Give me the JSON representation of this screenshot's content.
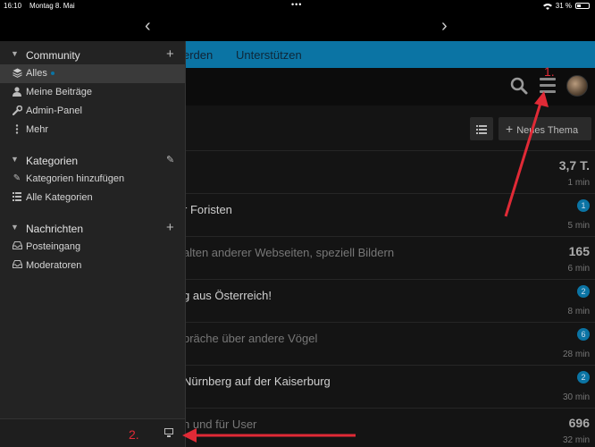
{
  "statusbar": {
    "time": "16:10",
    "date": "Montag 8. Mai",
    "dots": "•••",
    "battery": "31 %"
  },
  "browser": {
    "back": "‹",
    "forward": "›"
  },
  "header": {
    "nav_partial": "erden",
    "nav_support": "Unterstützen"
  },
  "toolbar": {
    "new_topic": "Neues Thema",
    "new_topic_plus": "+"
  },
  "topics": [
    {
      "title": "",
      "count": "3,7 T.",
      "badge": "",
      "age": "1 min",
      "read": false
    },
    {
      "title": "r Foristen",
      "count": "",
      "badge": "1",
      "age": "5 min",
      "read": false
    },
    {
      "title": "alten anderer Webseiten, speziell Bildern",
      "count": "165",
      "badge": "",
      "age": "6 min",
      "read": true
    },
    {
      "title": "g aus Österreich!",
      "count": "",
      "badge": "2",
      "age": "8 min",
      "read": false
    },
    {
      "title": "präche über andere Vögel",
      "count": "",
      "badge": "6",
      "age": "28 min",
      "read": false
    },
    {
      "title": "Nürnberg auf der Kaiserburg",
      "count": "",
      "badge": "2",
      "age": "30 min",
      "read": false
    },
    {
      "title": "n und für User",
      "count": "696",
      "badge": "",
      "age": "32 min",
      "read": true
    }
  ],
  "sidebar": {
    "community": {
      "title": "Community",
      "items": [
        {
          "label": "Alles",
          "icon": "layers-icon"
        },
        {
          "label": "Meine Beiträge",
          "icon": "user-icon"
        },
        {
          "label": "Admin-Panel",
          "icon": "wrench-icon"
        },
        {
          "label": "Mehr",
          "icon": "more-vertical-icon"
        }
      ]
    },
    "categories": {
      "title": "Kategorien",
      "items": [
        {
          "label": "Kategorien hinzufügen",
          "icon": "pencil-icon"
        },
        {
          "label": "Alle Kategorien",
          "icon": "list-icon"
        }
      ]
    },
    "messages": {
      "title": "Nachrichten",
      "items": [
        {
          "label": "Posteingang",
          "icon": "inbox-icon"
        },
        {
          "label": "Moderatoren",
          "icon": "inbox-icon"
        }
      ]
    }
  },
  "annotations": {
    "one": "1.",
    "two": "2."
  },
  "colors": {
    "accent": "#0b74a4",
    "annotation": "#e02a36",
    "sidebar": "#232323"
  }
}
